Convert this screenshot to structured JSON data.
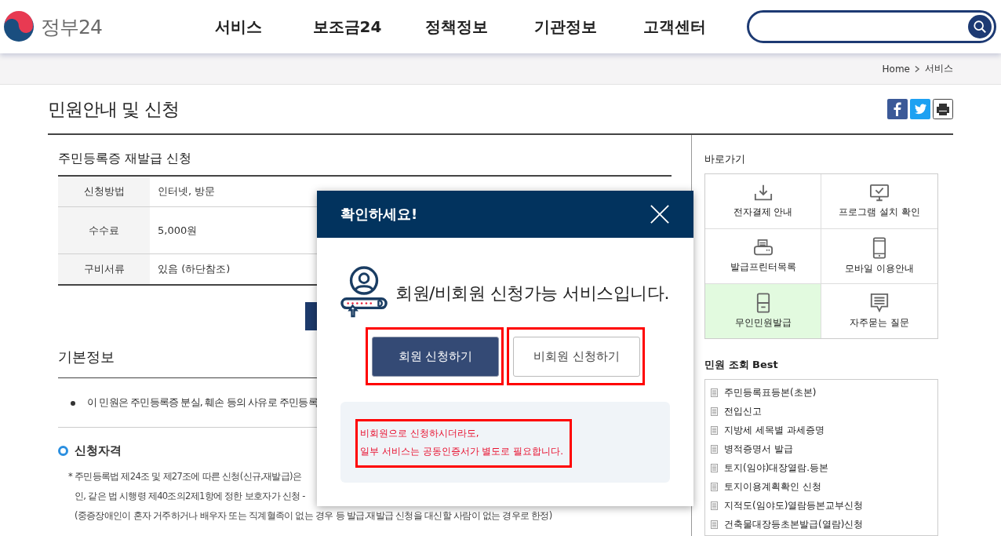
{
  "header": {
    "logo_text": "정부24",
    "nav": [
      "서비스",
      "보조금24",
      "정책정보",
      "기관정보",
      "고객센터"
    ]
  },
  "breadcrumb": [
    "Home",
    "서비스"
  ],
  "page_title": "민원안내 및 신청",
  "service": {
    "title": "주민등록증 재발급 신청",
    "rows": [
      {
        "label": "신청방법",
        "value": "인터넷, 방문"
      },
      {
        "label": "수수료",
        "value": "5,000원"
      },
      {
        "label": "구비서류",
        "value": "있음 (하단참조)"
      }
    ]
  },
  "basic_info": {
    "heading": "기본정보",
    "bullet": "이 민원은 주민등록증 분실, 훼손 등의 사유로 주민등록",
    "section": "신청자격",
    "notes": [
      "* 주민등록법 제24조 및 제27조에 따른 신청(신규,재발급)은",
      "인, 같은 법 시행령 제40조의2제1항에 정한 보호자가 신청 -",
      "(중증장애인이 혼자 거주하거나 배우자 또는 직계혈족이 없는 경우 등 발급.재발급 신청을 대신할 사람이 없는 경우로 한정)"
    ]
  },
  "sidebar": {
    "quick_title": "바로가기",
    "quick_links": [
      {
        "label": "전자결제 안내",
        "highlighted": false
      },
      {
        "label": "프로그램 설치 확인",
        "highlighted": false
      },
      {
        "label": "발급프린터목록",
        "highlighted": false
      },
      {
        "label": "모바일 이용안내",
        "highlighted": false
      },
      {
        "label": "무인민원발급",
        "highlighted": true
      },
      {
        "label": "자주묻는 질문",
        "highlighted": false
      }
    ],
    "best_title": "민원 조회 Best",
    "best": [
      "주민등록표등본(초본)",
      "전입신고",
      "지방세 세목별 과세증명",
      "병적증명서 발급",
      "토지(임야)대장열람.등본",
      "토지이용계획확인 신청",
      "지적도(임야도)열람등본교부신청",
      "건축물대장등초본발급(열람)신청"
    ]
  },
  "modal": {
    "title": "확인하세요!",
    "message": "회원/비회원 신청가능 서비스입니다.",
    "buttons": [
      {
        "label": "회원 신청하기",
        "kind": "primary",
        "highlighted": true
      },
      {
        "label": "비회원 신청하기",
        "kind": "secondary",
        "highlighted": true
      }
    ],
    "note": {
      "lines": [
        "비회원으로 신청하시더라도,",
        "일부 서비스는 공동인증서가 별도로 필요합니다."
      ],
      "highlighted": true
    }
  }
}
